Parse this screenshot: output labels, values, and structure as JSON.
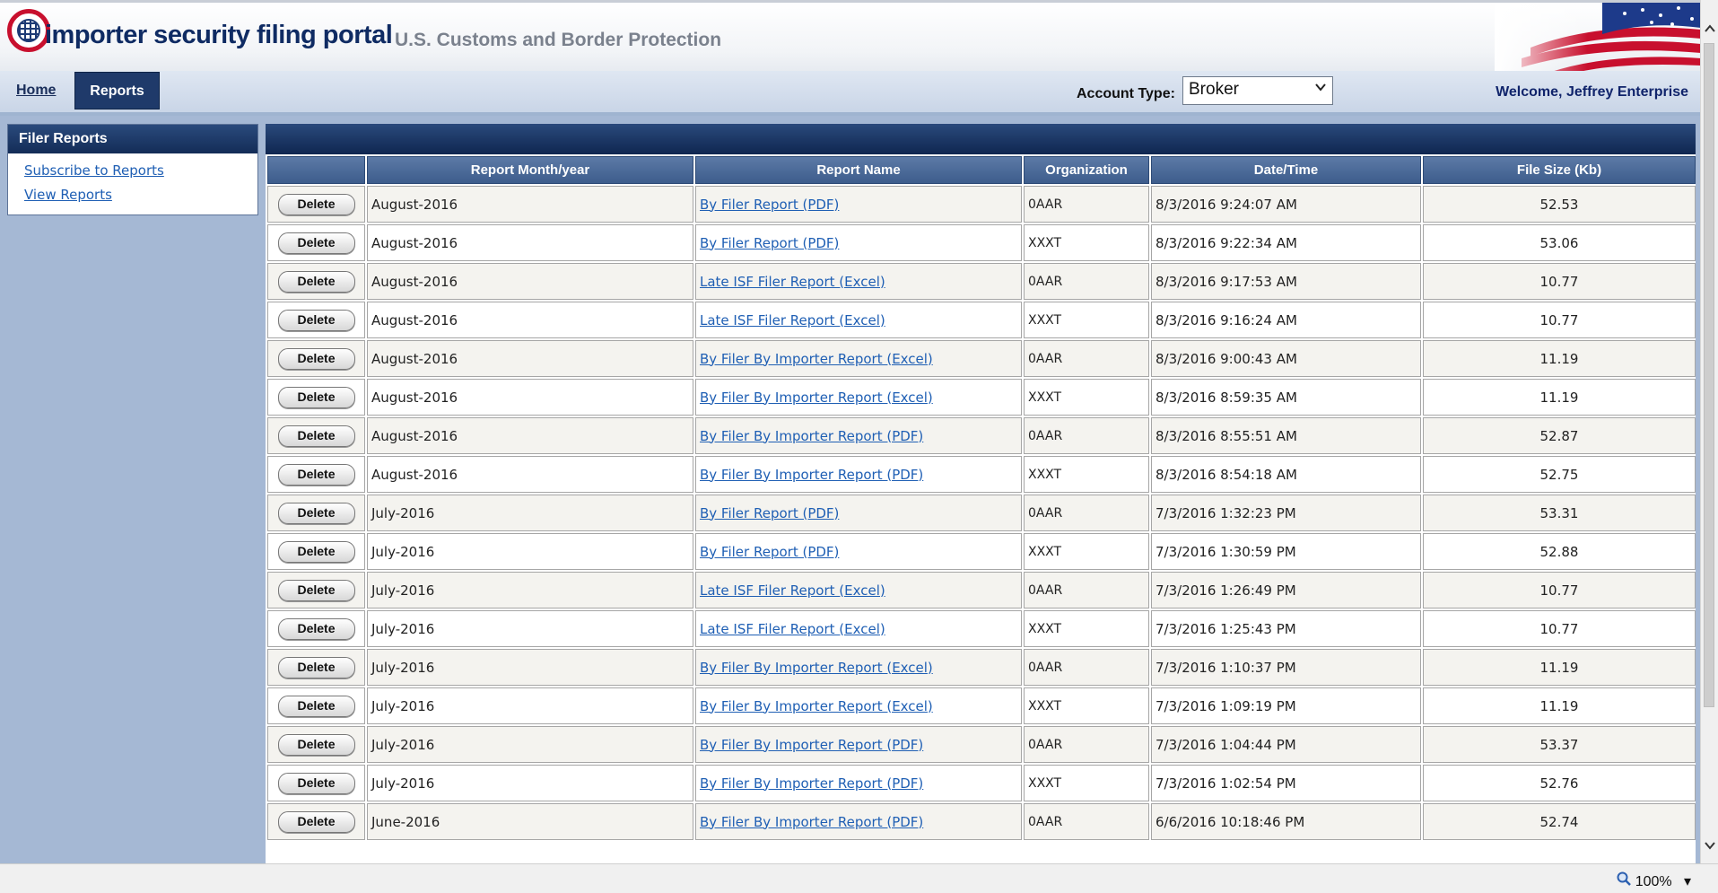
{
  "header": {
    "app_title": "importer security filing portal",
    "app_subtitle": "U.S. Customs and Border Protection"
  },
  "nav": {
    "home": "Home",
    "reports": "Reports",
    "account_type_label": "Account Type:",
    "account_type_value": "Broker",
    "welcome": "Welcome, Jeffrey Enterprise"
  },
  "sidebar": {
    "title": "Filer Reports",
    "links": [
      "Subscribe to Reports",
      "View Reports"
    ]
  },
  "table": {
    "columns": [
      "",
      "Report Month/year",
      "Report Name",
      "Organization",
      "Date/Time",
      "File Size (Kb)"
    ],
    "delete_label": "Delete",
    "rows": [
      {
        "month": "August-2016",
        "name": "By Filer Report (PDF)",
        "org": "0AAR",
        "datetime": "8/3/2016 9:24:07 AM",
        "size": "52.53"
      },
      {
        "month": "August-2016",
        "name": "By Filer Report (PDF)",
        "org": "XXXT",
        "datetime": "8/3/2016 9:22:34 AM",
        "size": "53.06"
      },
      {
        "month": "August-2016",
        "name": "Late ISF Filer Report (Excel)",
        "org": "0AAR",
        "datetime": "8/3/2016 9:17:53 AM",
        "size": "10.77"
      },
      {
        "month": "August-2016",
        "name": "Late ISF Filer Report (Excel)",
        "org": "XXXT",
        "datetime": "8/3/2016 9:16:24 AM",
        "size": "10.77"
      },
      {
        "month": "August-2016",
        "name": "By Filer By Importer Report (Excel)",
        "org": "0AAR",
        "datetime": "8/3/2016 9:00:43 AM",
        "size": "11.19"
      },
      {
        "month": "August-2016",
        "name": "By Filer By Importer Report (Excel)",
        "org": "XXXT",
        "datetime": "8/3/2016 8:59:35 AM",
        "size": "11.19"
      },
      {
        "month": "August-2016",
        "name": "By Filer By Importer Report (PDF)",
        "org": "0AAR",
        "datetime": "8/3/2016 8:55:51 AM",
        "size": "52.87"
      },
      {
        "month": "August-2016",
        "name": "By Filer By Importer Report (PDF)",
        "org": "XXXT",
        "datetime": "8/3/2016 8:54:18 AM",
        "size": "52.75"
      },
      {
        "month": "July-2016",
        "name": "By Filer Report (PDF)",
        "org": "0AAR",
        "datetime": "7/3/2016 1:32:23 PM",
        "size": "53.31"
      },
      {
        "month": "July-2016",
        "name": "By Filer Report (PDF)",
        "org": "XXXT",
        "datetime": "7/3/2016 1:30:59 PM",
        "size": "52.88"
      },
      {
        "month": "July-2016",
        "name": "Late ISF Filer Report (Excel)",
        "org": "0AAR",
        "datetime": "7/3/2016 1:26:49 PM",
        "size": "10.77"
      },
      {
        "month": "July-2016",
        "name": "Late ISF Filer Report (Excel)",
        "org": "XXXT",
        "datetime": "7/3/2016 1:25:43 PM",
        "size": "10.77"
      },
      {
        "month": "July-2016",
        "name": "By Filer By Importer Report (Excel)",
        "org": "0AAR",
        "datetime": "7/3/2016 1:10:37 PM",
        "size": "11.19"
      },
      {
        "month": "July-2016",
        "name": "By Filer By Importer Report (Excel)",
        "org": "XXXT",
        "datetime": "7/3/2016 1:09:19 PM",
        "size": "11.19"
      },
      {
        "month": "July-2016",
        "name": "By Filer By Importer Report (PDF)",
        "org": "0AAR",
        "datetime": "7/3/2016 1:04:44 PM",
        "size": "53.37"
      },
      {
        "month": "July-2016",
        "name": "By Filer By Importer Report (PDF)",
        "org": "XXXT",
        "datetime": "7/3/2016 1:02:54 PM",
        "size": "52.76"
      },
      {
        "month": "June-2016",
        "name": "By Filer By Importer Report (PDF)",
        "org": "0AAR",
        "datetime": "6/6/2016 10:18:46 PM",
        "size": "52.74"
      }
    ]
  },
  "statusbar": {
    "zoom": "100%"
  },
  "colors": {
    "brand_navy": "#1f3a6a",
    "header_title": "#0f2b63",
    "link": "#1f5fb4",
    "accent_red": "#c8102e",
    "background": "#a5b8d4"
  },
  "icons": [
    "cbp-logo-icon",
    "flag-icon",
    "chevron-down-icon",
    "scroll-up-icon",
    "scroll-down-icon",
    "zoom-icon"
  ]
}
